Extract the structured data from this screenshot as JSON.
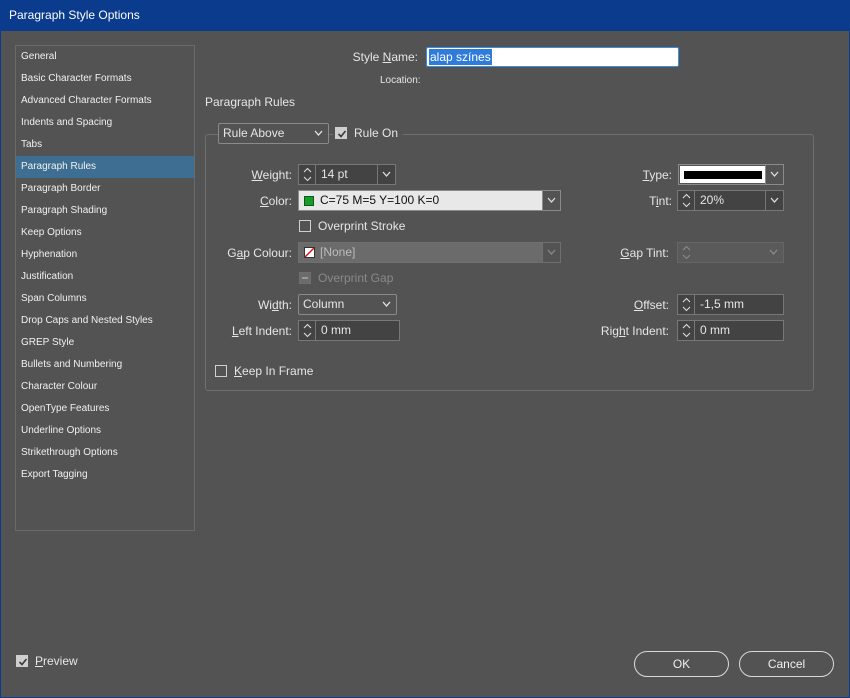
{
  "window": {
    "title": "Paragraph Style Options"
  },
  "sidebar": {
    "items": [
      {
        "label": "General"
      },
      {
        "label": "Basic Character Formats"
      },
      {
        "label": "Advanced Character Formats"
      },
      {
        "label": "Indents and Spacing"
      },
      {
        "label": "Tabs"
      },
      {
        "label": "Paragraph Rules",
        "selected": true
      },
      {
        "label": "Paragraph Border"
      },
      {
        "label": "Paragraph Shading"
      },
      {
        "label": "Keep Options"
      },
      {
        "label": "Hyphenation"
      },
      {
        "label": "Justification"
      },
      {
        "label": "Span Columns"
      },
      {
        "label": "Drop Caps and Nested Styles"
      },
      {
        "label": "GREP Style"
      },
      {
        "label": "Bullets and Numbering"
      },
      {
        "label": "Character Colour"
      },
      {
        "label": "OpenType Features"
      },
      {
        "label": "Underline Options"
      },
      {
        "label": "Strikethrough Options"
      },
      {
        "label": "Export Tagging"
      }
    ]
  },
  "header": {
    "style_name_label_pre": "Style ",
    "style_name_label_u": "N",
    "style_name_label_post": "ame:",
    "style_name_value": "alap színes",
    "location_label": "Location:",
    "section_title": "Paragraph Rules"
  },
  "rule": {
    "rule_select": "Rule Above",
    "rule_on_label": "Rule On",
    "rule_on_checked": true,
    "weight_label": "Weight:",
    "weight_value": "14 pt",
    "type_label": "Type:",
    "color_label": "Color:",
    "color_value": "C=75 M=5 Y=100 K=0",
    "color_swatch": "#1a9a2c",
    "tint_label": "Tint:",
    "tint_value": "20%",
    "overprint_stroke_label": "Overprint Stroke",
    "overprint_stroke_checked": false,
    "gap_colour_label": "Gap Colour:",
    "gap_colour_value": "[None]",
    "gap_tint_label": "Gap Tint:",
    "gap_tint_value": "",
    "overprint_gap_label": "Overprint Gap",
    "width_label": "Width:",
    "width_value": "Column",
    "offset_label": "Offset:",
    "offset_value": "-1,5 mm",
    "left_indent_label": "Left Indent:",
    "left_indent_value": "0 mm",
    "right_indent_label": "Right Indent:",
    "right_indent_value": "0 mm",
    "keep_in_frame_label": "Keep In Frame",
    "keep_in_frame_checked": false
  },
  "footer": {
    "preview_label": "Preview",
    "preview_checked": true,
    "ok_label": "OK",
    "cancel_label": "Cancel"
  },
  "colors": {
    "titlebar": "#0a3b8c",
    "background": "#535353",
    "selection": "#3e6f92",
    "input_focus": "#2e7bd9"
  }
}
